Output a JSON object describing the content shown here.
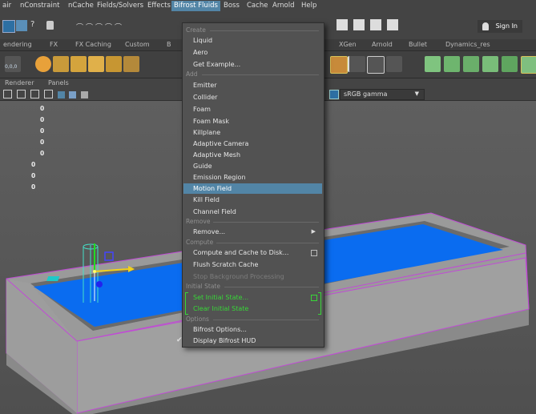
{
  "menubar": {
    "items": [
      "air",
      "nConstraint",
      "nCache",
      "Fields/Solvers",
      "Effects",
      "Bifrost Fluids",
      "Boss",
      "Cache",
      "Arnold",
      "Help"
    ],
    "sign_in": "Sign In"
  },
  "shelf_tabs": [
    "endering",
    "FX",
    "FX Caching",
    "Custom",
    "B",
    "XGen",
    "Arnold",
    "Bullet",
    "Dynamics_res"
  ],
  "panel_menu": [
    "Renderer",
    "Panels"
  ],
  "color_space": "sRGB gamma",
  "hud_values": [
    "0",
    "0",
    "0",
    "0",
    "0",
    "0",
    "0",
    "0",
    "0"
  ],
  "hud_vertex": "0,0,0",
  "dropdown": {
    "sections": {
      "create": "Create",
      "add": "Add",
      "remove": "Remove",
      "compute": "Compute",
      "initial_state": "Initial State",
      "options": "Options"
    },
    "create_items": [
      "Liquid",
      "Aero",
      "Get Example..."
    ],
    "add_items": [
      "Emitter",
      "Collider",
      "Foam",
      "Foam Mask",
      "Killplane",
      "Adaptive Camera",
      "Adaptive Mesh",
      "Guide",
      "Emission Region",
      "Motion Field",
      "Kill Field",
      "Channel Field"
    ],
    "remove_items": [
      "Remove..."
    ],
    "compute_items": [
      "Compute and Cache to Disk...",
      "Flush Scratch Cache",
      "Stop Background Processing"
    ],
    "initial_state_items": [
      "Set Initial State...",
      "Clear Initial State"
    ],
    "options_items": [
      "Bifrost Options...",
      "Display Bifrost HUD"
    ],
    "highlighted": "Motion Field"
  },
  "colors": {
    "menu_bg": "#525252",
    "highlight": "#5285a6",
    "water": "#0a6cf0",
    "green_text": "#37d737"
  }
}
